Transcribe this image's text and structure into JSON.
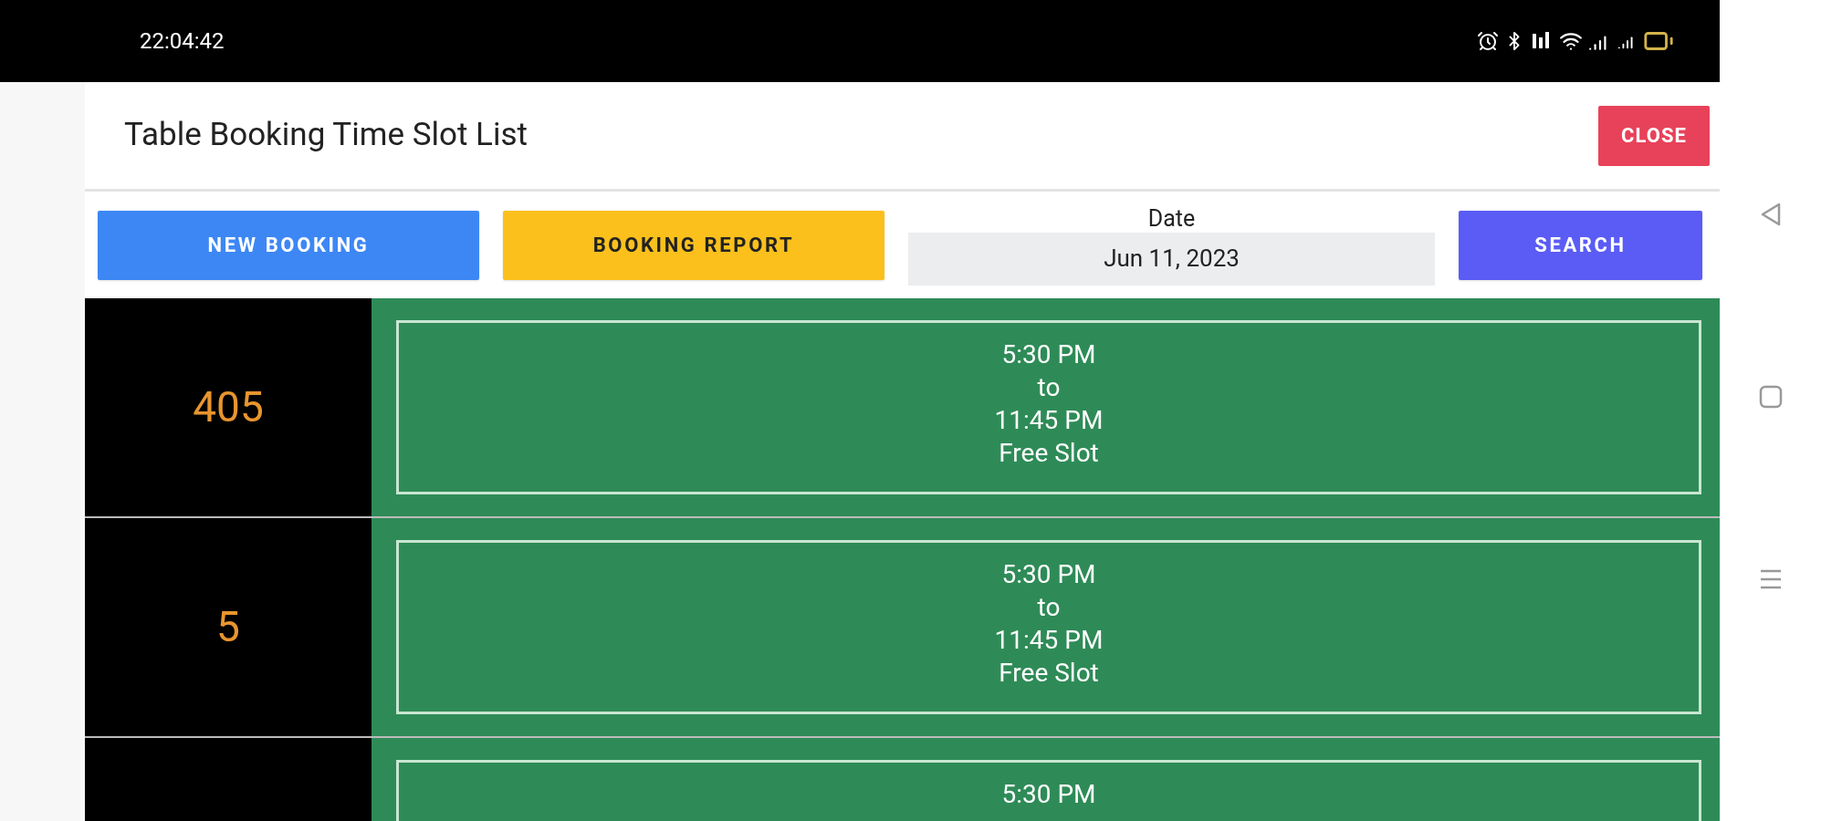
{
  "status_bar": {
    "time": "22:04:42"
  },
  "header": {
    "title": "Table Booking Time Slot List",
    "close_button": "CLOSE"
  },
  "toolbar": {
    "new_booking": "NEW BOOKING",
    "booking_report": "BOOKING REPORT",
    "date_label": "Date",
    "date_value": "Jun 11, 2023",
    "search": "SEARCH"
  },
  "rows": [
    {
      "table": "405",
      "slot": [
        "5:30 PM",
        "to",
        "11:45 PM",
        "Free Slot"
      ]
    },
    {
      "table": "5",
      "slot": [
        "5:30 PM",
        "to",
        "11:45 PM",
        "Free Slot"
      ]
    },
    {
      "slot": [
        "5:30 PM"
      ]
    }
  ]
}
